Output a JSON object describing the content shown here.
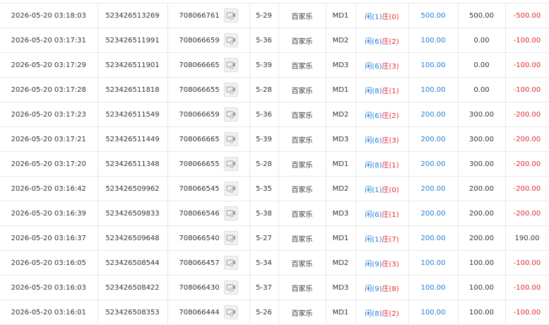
{
  "icon": "video-replay-icon",
  "colors": {
    "player": "#1e7bd9",
    "banker": "#e22b2b",
    "bet": "#1e7bd9",
    "loss": "#e22b2b",
    "text": "#333333",
    "border": "#e8e8e8"
  },
  "labels": {
    "player": "闲",
    "banker": "庄"
  },
  "rows": [
    {
      "time": "2026-05-20 03:18:03",
      "order_id": "523426513269",
      "round_id": "708066761",
      "shoe": "5-29",
      "game": "百家乐",
      "table": "MD1",
      "player_points": "(1)",
      "banker_points": "(0)",
      "bet": "500.00",
      "valid_bet": "500.00",
      "win_loss": "-500.00"
    },
    {
      "time": "2026-05-20 03:17:31",
      "order_id": "523426511991",
      "round_id": "708066659",
      "shoe": "5-36",
      "game": "百家乐",
      "table": "MD2",
      "player_points": "(6)",
      "banker_points": "(2)",
      "bet": "100.00",
      "valid_bet": "0.00",
      "win_loss": "-100.00"
    },
    {
      "time": "2026-05-20 03:17:29",
      "order_id": "523426511901",
      "round_id": "708066665",
      "shoe": "5-39",
      "game": "百家乐",
      "table": "MD3",
      "player_points": "(6)",
      "banker_points": "(3)",
      "bet": "100.00",
      "valid_bet": "0.00",
      "win_loss": "-100.00"
    },
    {
      "time": "2026-05-20 03:17:28",
      "order_id": "523426511818",
      "round_id": "708066655",
      "shoe": "5-28",
      "game": "百家乐",
      "table": "MD1",
      "player_points": "(8)",
      "banker_points": "(1)",
      "bet": "100.00",
      "valid_bet": "0.00",
      "win_loss": "-100.00"
    },
    {
      "time": "2026-05-20 03:17:23",
      "order_id": "523426511549",
      "round_id": "708066659",
      "shoe": "5-36",
      "game": "百家乐",
      "table": "MD2",
      "player_points": "(6)",
      "banker_points": "(2)",
      "bet": "200.00",
      "valid_bet": "300.00",
      "win_loss": "-200.00"
    },
    {
      "time": "2026-05-20 03:17:21",
      "order_id": "523426511449",
      "round_id": "708066665",
      "shoe": "5-39",
      "game": "百家乐",
      "table": "MD3",
      "player_points": "(6)",
      "banker_points": "(3)",
      "bet": "200.00",
      "valid_bet": "300.00",
      "win_loss": "-200.00"
    },
    {
      "time": "2026-05-20 03:17:20",
      "order_id": "523426511348",
      "round_id": "708066655",
      "shoe": "5-28",
      "game": "百家乐",
      "table": "MD1",
      "player_points": "(8)",
      "banker_points": "(1)",
      "bet": "200.00",
      "valid_bet": "300.00",
      "win_loss": "-200.00"
    },
    {
      "time": "2026-05-20 03:16:42",
      "order_id": "523426509962",
      "round_id": "708066545",
      "shoe": "5-35",
      "game": "百家乐",
      "table": "MD2",
      "player_points": "(1)",
      "banker_points": "(0)",
      "bet": "200.00",
      "valid_bet": "200.00",
      "win_loss": "-200.00"
    },
    {
      "time": "2026-05-20 03:16:39",
      "order_id": "523426509833",
      "round_id": "708066546",
      "shoe": "5-38",
      "game": "百家乐",
      "table": "MD3",
      "player_points": "(6)",
      "banker_points": "(1)",
      "bet": "200.00",
      "valid_bet": "200.00",
      "win_loss": "-200.00"
    },
    {
      "time": "2026-05-20 03:16:37",
      "order_id": "523426509648",
      "round_id": "708066540",
      "shoe": "5-27",
      "game": "百家乐",
      "table": "MD1",
      "player_points": "(1)",
      "banker_points": "(7)",
      "bet": "200.00",
      "valid_bet": "200.00",
      "win_loss": "190.00"
    },
    {
      "time": "2026-05-20 03:16:05",
      "order_id": "523426508544",
      "round_id": "708066457",
      "shoe": "5-34",
      "game": "百家乐",
      "table": "MD2",
      "player_points": "(9)",
      "banker_points": "(3)",
      "bet": "100.00",
      "valid_bet": "100.00",
      "win_loss": "-100.00"
    },
    {
      "time": "2026-05-20 03:16:03",
      "order_id": "523426508422",
      "round_id": "708066430",
      "shoe": "5-37",
      "game": "百家乐",
      "table": "MD3",
      "player_points": "(9)",
      "banker_points": "(8)",
      "bet": "100.00",
      "valid_bet": "100.00",
      "win_loss": "-100.00"
    },
    {
      "time": "2026-05-20 03:16:01",
      "order_id": "523426508353",
      "round_id": "708066444",
      "shoe": "5-26",
      "game": "百家乐",
      "table": "MD1",
      "player_points": "(8)",
      "banker_points": "(2)",
      "bet": "100.00",
      "valid_bet": "100.00",
      "win_loss": "-100.00"
    }
  ]
}
